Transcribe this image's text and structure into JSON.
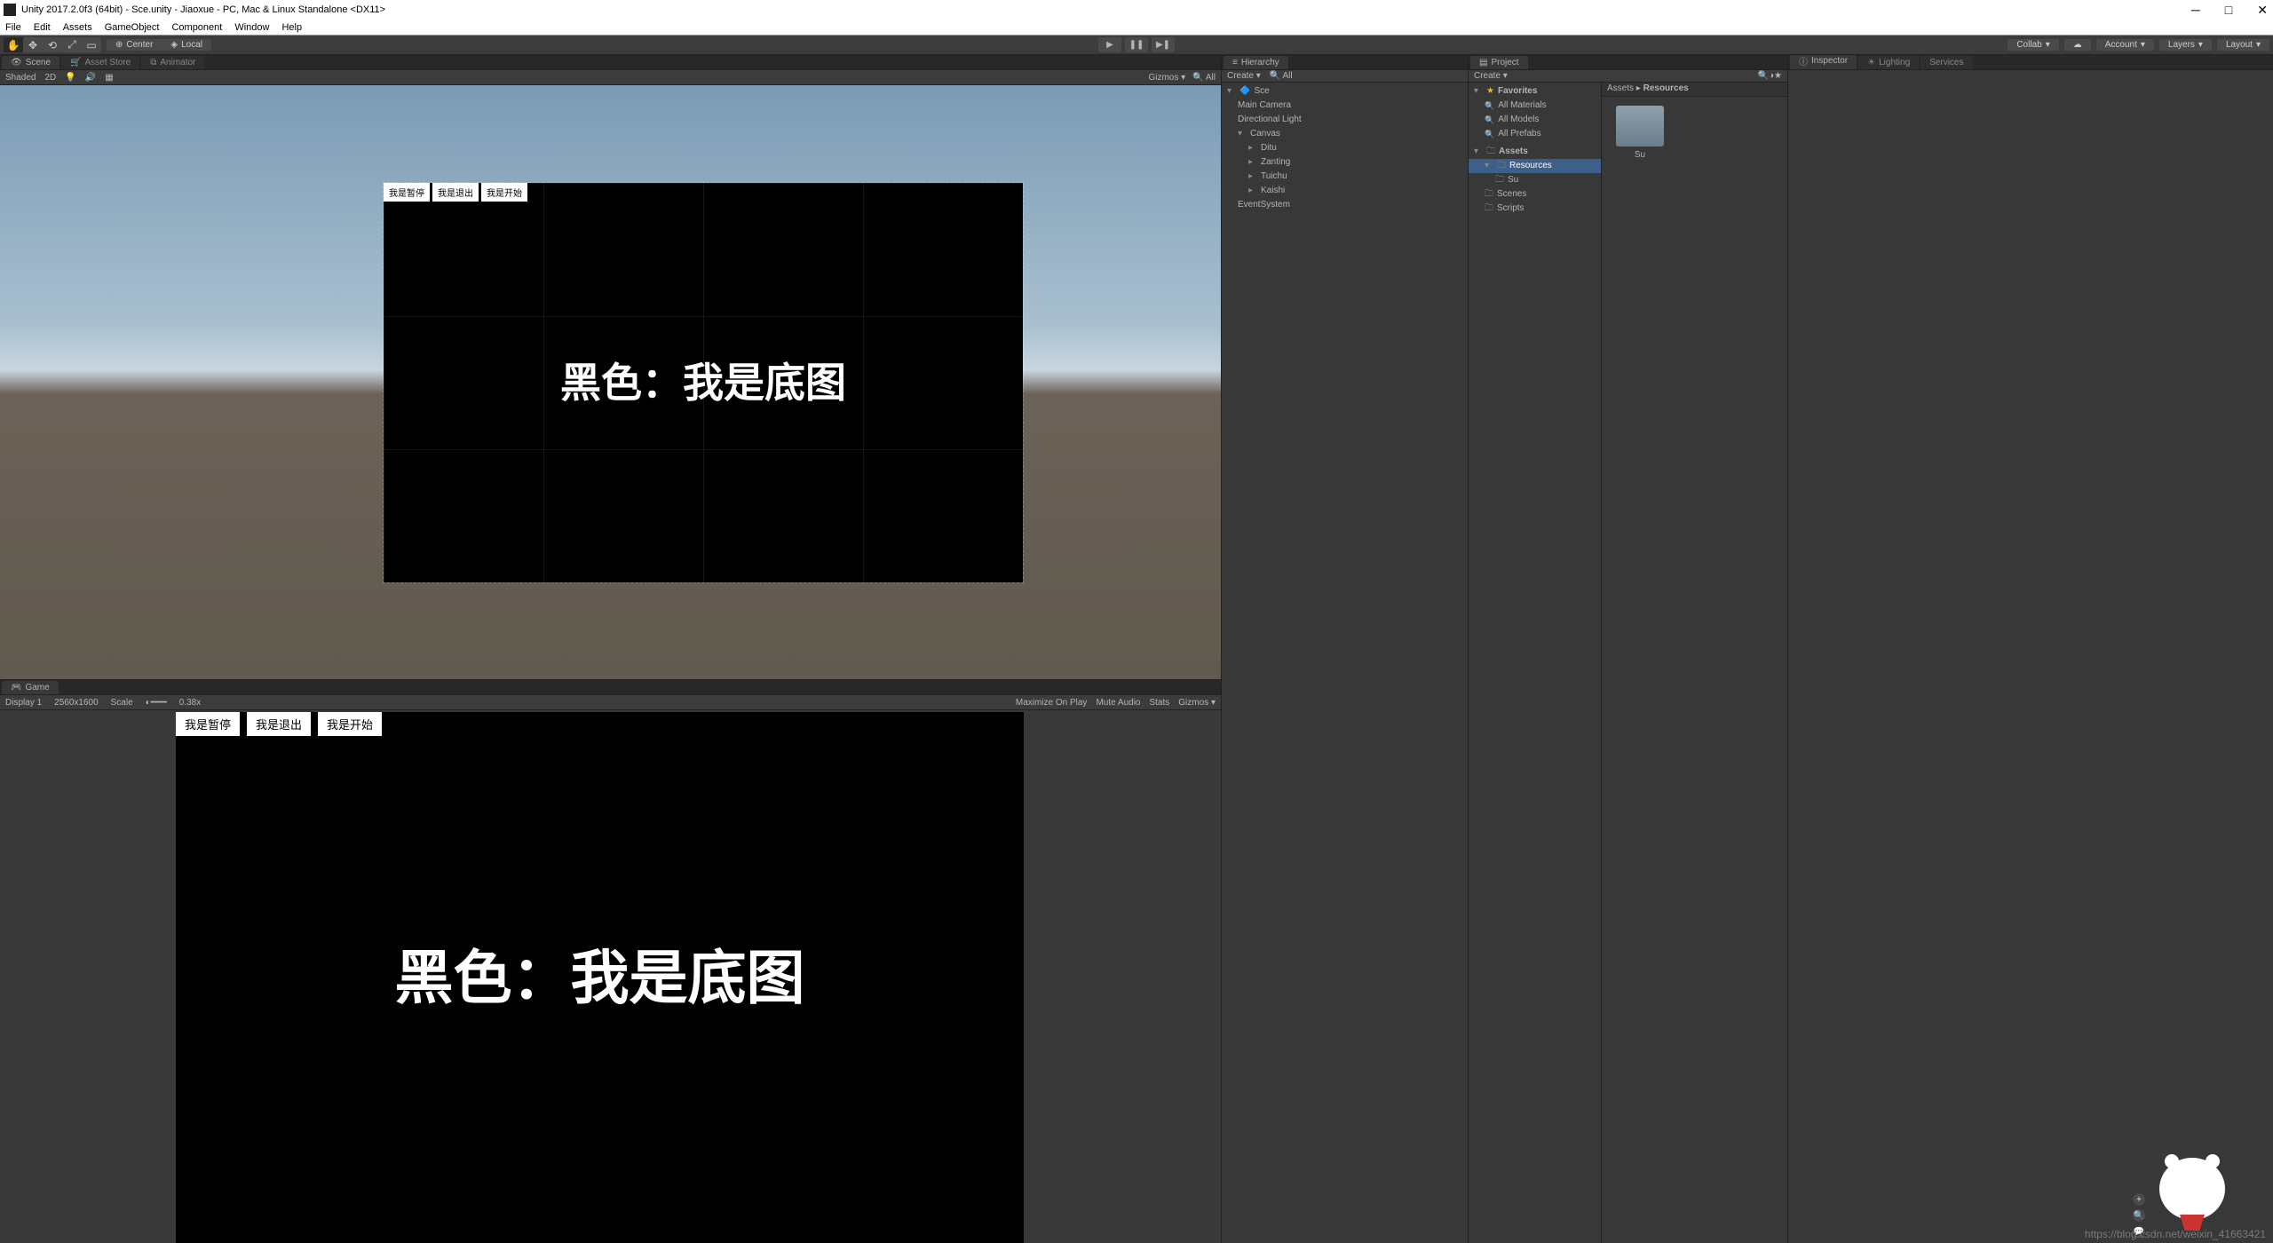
{
  "title": "Unity 2017.2.0f3 (64bit) - Sce.unity - Jiaoxue - PC, Mac & Linux Standalone <DX11>",
  "menu": {
    "file": "File",
    "edit": "Edit",
    "assets": "Assets",
    "gameobject": "GameObject",
    "component": "Component",
    "window": "Window",
    "help": "Help"
  },
  "toolbar": {
    "center": "Center",
    "local": "Local",
    "collab": "Collab",
    "account": "Account",
    "layers": "Layers",
    "layout": "Layout"
  },
  "tabs": {
    "scene": "Scene",
    "assetstore": "Asset Store",
    "animator": "Animator",
    "game": "Game",
    "hierarchy": "Hierarchy",
    "project": "Project",
    "inspector": "Inspector",
    "lighting": "Lighting",
    "services": "Services"
  },
  "scene_toolbar": {
    "shaded": "Shaded",
    "mode2d": "2D",
    "gizmos": "Gizmos",
    "all": "All"
  },
  "scene_content": {
    "text": "黑色：我是底图",
    "btn_pause": "我是暂停",
    "btn_exit": "我是退出",
    "btn_start": "我是开始"
  },
  "game_toolbar": {
    "display": "Display 1",
    "res": "2560x1600",
    "scale": "Scale",
    "scale_val": "0.38x",
    "max": "Maximize On Play",
    "mute": "Mute Audio",
    "stats": "Stats",
    "gizmos": "Gizmos"
  },
  "game_content": {
    "text": "黑色：我是底图",
    "btn_pause": "我是暂停",
    "btn_exit": "我是退出",
    "btn_start": "我是开始"
  },
  "hierarchy": {
    "create": "Create",
    "all": "All",
    "scene": "Sce",
    "items": {
      "camera": "Main Camera",
      "light": "Directional Light",
      "canvas": "Canvas",
      "ditu": "Ditu",
      "zanting": "Zanting",
      "tuichu": "Tuichu",
      "kaishi": "Kaishi",
      "eventsystem": "EventSystem"
    }
  },
  "project": {
    "create": "Create",
    "favorites": "Favorites",
    "fav_items": {
      "materials": "All Materials",
      "models": "All Models",
      "prefabs": "All Prefabs"
    },
    "assets": "Assets",
    "resources": "Resources",
    "su": "Su",
    "scenes": "Scenes",
    "scripts": "Scripts",
    "breadcrumb_assets": "Assets",
    "breadcrumb_resources": "Resources",
    "asset_su": "Su"
  },
  "watermark": "https://blog.csdn.net/weixin_41663421"
}
